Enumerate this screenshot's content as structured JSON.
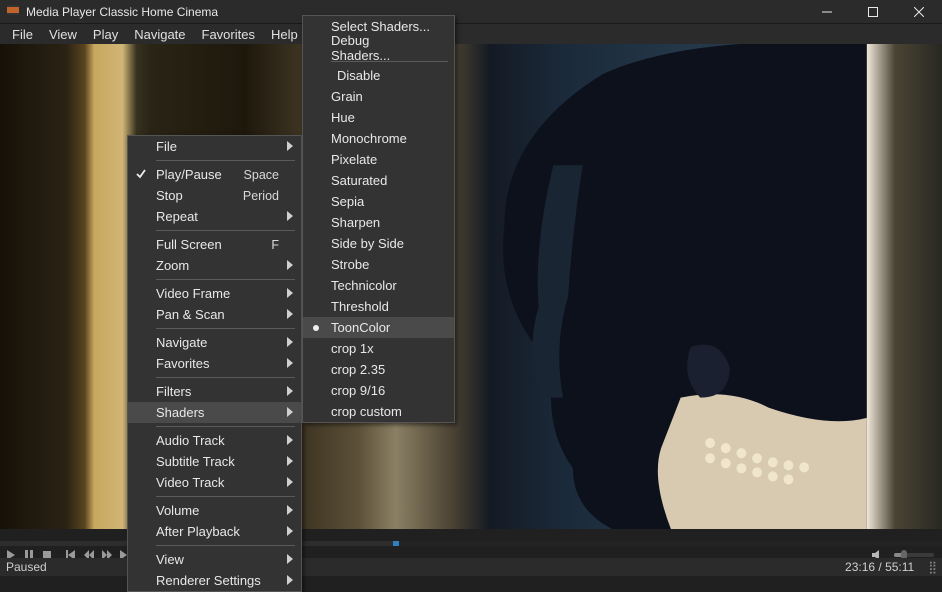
{
  "title": "Media Player Classic Home Cinema",
  "menubar": [
    "File",
    "View",
    "Play",
    "Navigate",
    "Favorites",
    "Help"
  ],
  "status": {
    "state": "Paused",
    "time": "23:16 / 55:11"
  },
  "timeline": {
    "progress_pct": 42,
    "mark_pct": 42
  },
  "volume": {
    "level_pct": 24
  },
  "ctx_main": {
    "items": [
      {
        "type": "sub",
        "label": "File"
      },
      {
        "type": "sep"
      },
      {
        "type": "item",
        "label": "Play/Pause",
        "accel": "Space",
        "checked": true
      },
      {
        "type": "item",
        "label": "Stop",
        "accel": "Period"
      },
      {
        "type": "sub",
        "label": "Repeat"
      },
      {
        "type": "sep"
      },
      {
        "type": "item",
        "label": "Full Screen",
        "accel": "F"
      },
      {
        "type": "sub",
        "label": "Zoom"
      },
      {
        "type": "sep"
      },
      {
        "type": "sub",
        "label": "Video Frame"
      },
      {
        "type": "sub",
        "label": "Pan & Scan"
      },
      {
        "type": "sep"
      },
      {
        "type": "sub",
        "label": "Navigate"
      },
      {
        "type": "sub",
        "label": "Favorites"
      },
      {
        "type": "sep"
      },
      {
        "type": "sub",
        "label": "Filters"
      },
      {
        "type": "sub",
        "label": "Shaders",
        "highlight": true
      },
      {
        "type": "sep"
      },
      {
        "type": "sub",
        "label": "Audio Track"
      },
      {
        "type": "sub",
        "label": "Subtitle Track"
      },
      {
        "type": "sub",
        "label": "Video Track"
      },
      {
        "type": "sep"
      },
      {
        "type": "sub",
        "label": "Volume"
      },
      {
        "type": "sub",
        "label": "After Playback"
      },
      {
        "type": "sep"
      },
      {
        "type": "sub",
        "label": "View"
      },
      {
        "type": "sub",
        "label": "Renderer Settings"
      }
    ]
  },
  "ctx_shaders": {
    "items": [
      {
        "type": "item",
        "label": "Select Shaders..."
      },
      {
        "type": "item",
        "label": "Debug Shaders..."
      },
      {
        "type": "sep"
      },
      {
        "type": "item",
        "label": "Disable",
        "indent": true
      },
      {
        "type": "item",
        "label": "Grain"
      },
      {
        "type": "item",
        "label": "Hue"
      },
      {
        "type": "item",
        "label": "Monochrome"
      },
      {
        "type": "item",
        "label": "Pixelate"
      },
      {
        "type": "item",
        "label": "Saturated"
      },
      {
        "type": "item",
        "label": "Sepia"
      },
      {
        "type": "item",
        "label": "Sharpen"
      },
      {
        "type": "item",
        "label": "Side by Side"
      },
      {
        "type": "item",
        "label": "Strobe"
      },
      {
        "type": "item",
        "label": "Technicolor"
      },
      {
        "type": "item",
        "label": "Threshold"
      },
      {
        "type": "item",
        "label": "ToonColor",
        "radio": true,
        "highlight": true
      },
      {
        "type": "item",
        "label": "crop 1x"
      },
      {
        "type": "item",
        "label": "crop 2.35"
      },
      {
        "type": "item",
        "label": "crop 9/16"
      },
      {
        "type": "item",
        "label": "crop custom"
      }
    ]
  }
}
